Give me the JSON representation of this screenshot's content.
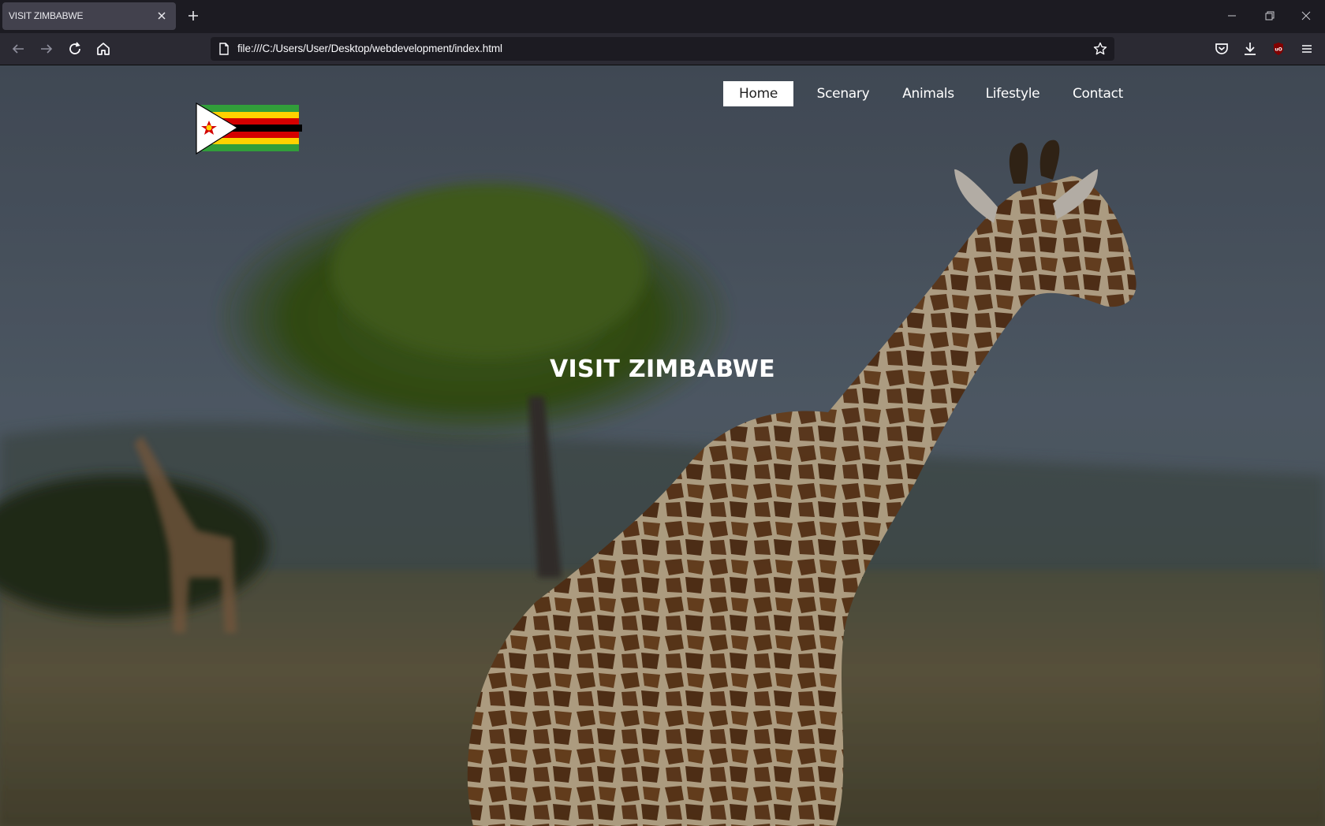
{
  "browser": {
    "tab_title": "VISIT ZIMBABWE",
    "url": "file:///C:/Users/User/Desktop/webdevelopment/index.html"
  },
  "site": {
    "nav": [
      {
        "label": "Home",
        "active": true
      },
      {
        "label": "Scenary",
        "active": false
      },
      {
        "label": "Animals",
        "active": false
      },
      {
        "label": "Lifestyle",
        "active": false
      },
      {
        "label": "Contact",
        "active": false
      }
    ],
    "hero_title": "VISIT ZIMBABWE"
  },
  "colors": {
    "tabstrip": "#1c1b22",
    "toolbar": "#2b2a33",
    "active_nav_bg": "#ffffff",
    "flag_green": "#319e3a",
    "flag_yellow": "#ffd200",
    "flag_red": "#d40000",
    "flag_black": "#000000"
  }
}
